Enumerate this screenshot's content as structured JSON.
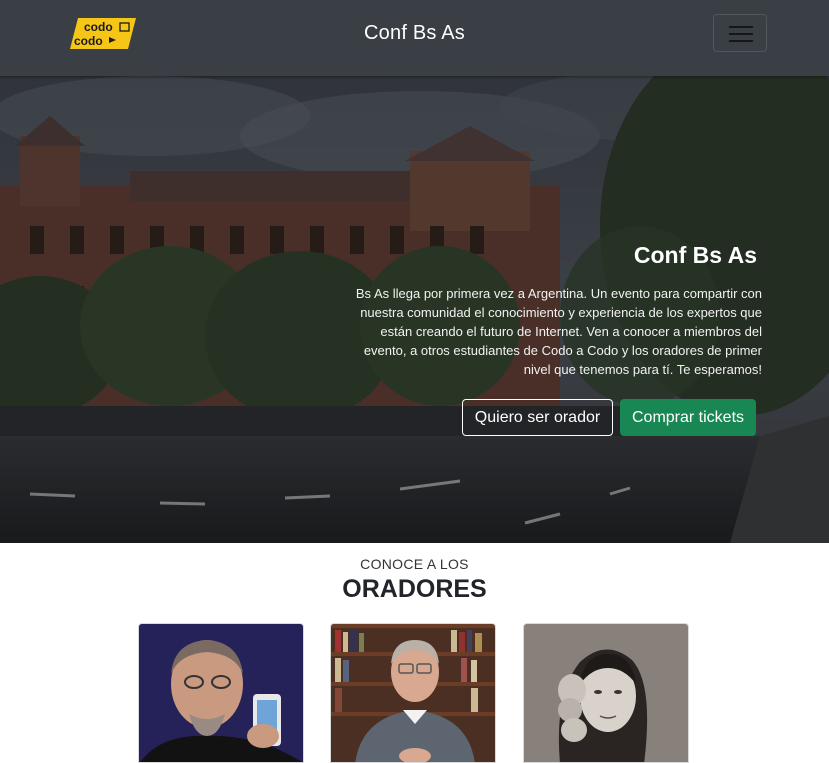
{
  "navbar": {
    "logo_line1": "codo",
    "logo_line2": "codo",
    "title": "Conf Bs As",
    "menu_icon": "hamburger-icon"
  },
  "hero": {
    "title": "Conf Bs As",
    "description": "Bs As llega por primera vez a Argentina. Un evento para compartir con nuestra comunidad el conocimiento y experiencia de los expertos que están creando el futuro de Internet. Ven a conocer a miembros del evento, a otros estudiantes de Codo a Codo y los oradores de primer nivel que tenemos para tí. Te esperamos!",
    "button_speaker": "Quiero ser orador",
    "button_tickets": "Comprar tickets"
  },
  "speakers": {
    "kicker": "CONOCE A LOS",
    "title": "ORADORES"
  },
  "colors": {
    "navbar": "#3a3f45",
    "logo": "#f5c518",
    "accent_green": "#198754"
  }
}
